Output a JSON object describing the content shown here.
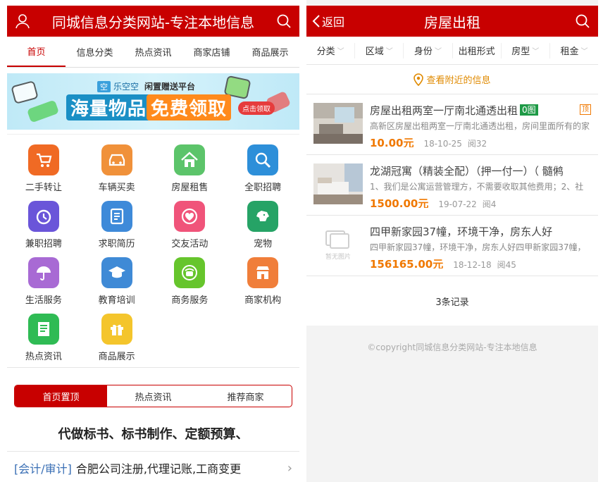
{
  "left": {
    "header": {
      "title": "同城信息分类网站-专注本地信息"
    },
    "tabs": [
      {
        "label": "首页",
        "active": true
      },
      {
        "label": "信息分类",
        "active": false
      },
      {
        "label": "热点资讯",
        "active": false
      },
      {
        "label": "商家店铺",
        "active": false
      },
      {
        "label": "商品展示",
        "active": false
      }
    ],
    "banner": {
      "brand": "乐空空",
      "brand_mark": "空",
      "tagline": "闲置赠送平台",
      "headline_a": "海量物品",
      "headline_b": "免费领取",
      "cta": "点击领取"
    },
    "categories": [
      {
        "label": "二手转让",
        "icon": "cart-icon",
        "color": "#f06a24"
      },
      {
        "label": "车辆买卖",
        "icon": "car-icon",
        "color": "#f0913a"
      },
      {
        "label": "房屋租售",
        "icon": "house-icon",
        "color": "#5cc46a"
      },
      {
        "label": "全职招聘",
        "icon": "magnifier-icon",
        "color": "#2d8fd9"
      },
      {
        "label": "兼职招聘",
        "icon": "clock-icon",
        "color": "#6a55d9"
      },
      {
        "label": "求职简历",
        "icon": "document-icon",
        "color": "#3e8ad9"
      },
      {
        "label": "交友活动",
        "icon": "heart-icon",
        "color": "#f0547a"
      },
      {
        "label": "宠物",
        "icon": "dog-icon",
        "color": "#26a366"
      },
      {
        "label": "生活服务",
        "icon": "umbrella-icon",
        "color": "#a86ad4"
      },
      {
        "label": "教育培训",
        "icon": "graduation-cap-icon",
        "color": "#3f8ad6"
      },
      {
        "label": "商务服务",
        "icon": "phone-icon",
        "color": "#66c52c"
      },
      {
        "label": "商家机构",
        "icon": "store-icon",
        "color": "#f07e3a"
      },
      {
        "label": "热点资讯",
        "icon": "news-icon",
        "color": "#2fbb54"
      },
      {
        "label": "商品展示",
        "icon": "gift-icon",
        "color": "#f4c52c"
      }
    ],
    "segments": [
      {
        "label": "首页置顶",
        "active": true
      },
      {
        "label": "热点资讯",
        "active": false
      },
      {
        "label": "推荐商家",
        "active": false
      }
    ],
    "promo_title": "代做标书、标书制作、定额预算、",
    "list_item": {
      "tag": "[会计/审计]",
      "text": "合肥公司注册,代理记账,工商变更",
      "arrow": "›"
    }
  },
  "right": {
    "header": {
      "back_label": "返回",
      "title": "房屋出租"
    },
    "filters": [
      "分类",
      "区域",
      "身份",
      "出租形式",
      "房型",
      "租金"
    ],
    "nearby_label": "查看附近的信息",
    "listings": [
      {
        "title": "房屋出租两室一厅南北通透出租",
        "pic_badge": "0图",
        "top_badge": "顶",
        "desc": "高新区房屋出租两室一厅南北通透出租，房间里面所有的家",
        "price": "10.00元",
        "date": "18-10-25",
        "views": "阅32",
        "thumb": "room-photo"
      },
      {
        "title": "龙湖冠寓（精装全配）（押一付一）（ 髓鸺",
        "pic_badge": "",
        "top_badge": "",
        "desc": "1、我们是公寓运营管理方，不需要收取其他费用；2、社",
        "price": "1500.00元",
        "date": "19-07-22",
        "views": "阅4",
        "thumb": "bedroom-photo"
      },
      {
        "title": "四甲新家园37幢，环境干净，房东人好",
        "pic_badge": "",
        "top_badge": "",
        "desc": "四甲新家园37幢，环境干净，房东人好四甲新家园37幢，",
        "price": "156165.00元",
        "date": "18-12-18",
        "views": "阅45",
        "thumb": "no-image-placeholder",
        "placeholder_text": "暂无图片"
      }
    ],
    "count_label": "3条记录",
    "copyright": "©copyright同城信息分类网站-专注本地信息"
  }
}
